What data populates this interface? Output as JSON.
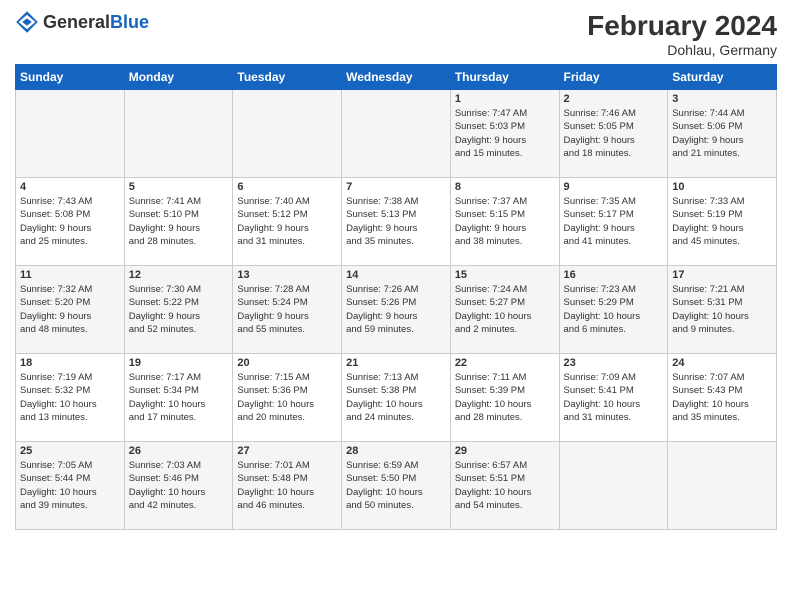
{
  "header": {
    "logo_general": "General",
    "logo_blue": "Blue",
    "main_title": "February 2024",
    "subtitle": "Dohlau, Germany"
  },
  "columns": [
    "Sunday",
    "Monday",
    "Tuesday",
    "Wednesday",
    "Thursday",
    "Friday",
    "Saturday"
  ],
  "weeks": [
    [
      {
        "day": "",
        "info": ""
      },
      {
        "day": "",
        "info": ""
      },
      {
        "day": "",
        "info": ""
      },
      {
        "day": "",
        "info": ""
      },
      {
        "day": "1",
        "info": "Sunrise: 7:47 AM\nSunset: 5:03 PM\nDaylight: 9 hours\nand 15 minutes."
      },
      {
        "day": "2",
        "info": "Sunrise: 7:46 AM\nSunset: 5:05 PM\nDaylight: 9 hours\nand 18 minutes."
      },
      {
        "day": "3",
        "info": "Sunrise: 7:44 AM\nSunset: 5:06 PM\nDaylight: 9 hours\nand 21 minutes."
      }
    ],
    [
      {
        "day": "4",
        "info": "Sunrise: 7:43 AM\nSunset: 5:08 PM\nDaylight: 9 hours\nand 25 minutes."
      },
      {
        "day": "5",
        "info": "Sunrise: 7:41 AM\nSunset: 5:10 PM\nDaylight: 9 hours\nand 28 minutes."
      },
      {
        "day": "6",
        "info": "Sunrise: 7:40 AM\nSunset: 5:12 PM\nDaylight: 9 hours\nand 31 minutes."
      },
      {
        "day": "7",
        "info": "Sunrise: 7:38 AM\nSunset: 5:13 PM\nDaylight: 9 hours\nand 35 minutes."
      },
      {
        "day": "8",
        "info": "Sunrise: 7:37 AM\nSunset: 5:15 PM\nDaylight: 9 hours\nand 38 minutes."
      },
      {
        "day": "9",
        "info": "Sunrise: 7:35 AM\nSunset: 5:17 PM\nDaylight: 9 hours\nand 41 minutes."
      },
      {
        "day": "10",
        "info": "Sunrise: 7:33 AM\nSunset: 5:19 PM\nDaylight: 9 hours\nand 45 minutes."
      }
    ],
    [
      {
        "day": "11",
        "info": "Sunrise: 7:32 AM\nSunset: 5:20 PM\nDaylight: 9 hours\nand 48 minutes."
      },
      {
        "day": "12",
        "info": "Sunrise: 7:30 AM\nSunset: 5:22 PM\nDaylight: 9 hours\nand 52 minutes."
      },
      {
        "day": "13",
        "info": "Sunrise: 7:28 AM\nSunset: 5:24 PM\nDaylight: 9 hours\nand 55 minutes."
      },
      {
        "day": "14",
        "info": "Sunrise: 7:26 AM\nSunset: 5:26 PM\nDaylight: 9 hours\nand 59 minutes."
      },
      {
        "day": "15",
        "info": "Sunrise: 7:24 AM\nSunset: 5:27 PM\nDaylight: 10 hours\nand 2 minutes."
      },
      {
        "day": "16",
        "info": "Sunrise: 7:23 AM\nSunset: 5:29 PM\nDaylight: 10 hours\nand 6 minutes."
      },
      {
        "day": "17",
        "info": "Sunrise: 7:21 AM\nSunset: 5:31 PM\nDaylight: 10 hours\nand 9 minutes."
      }
    ],
    [
      {
        "day": "18",
        "info": "Sunrise: 7:19 AM\nSunset: 5:32 PM\nDaylight: 10 hours\nand 13 minutes."
      },
      {
        "day": "19",
        "info": "Sunrise: 7:17 AM\nSunset: 5:34 PM\nDaylight: 10 hours\nand 17 minutes."
      },
      {
        "day": "20",
        "info": "Sunrise: 7:15 AM\nSunset: 5:36 PM\nDaylight: 10 hours\nand 20 minutes."
      },
      {
        "day": "21",
        "info": "Sunrise: 7:13 AM\nSunset: 5:38 PM\nDaylight: 10 hours\nand 24 minutes."
      },
      {
        "day": "22",
        "info": "Sunrise: 7:11 AM\nSunset: 5:39 PM\nDaylight: 10 hours\nand 28 minutes."
      },
      {
        "day": "23",
        "info": "Sunrise: 7:09 AM\nSunset: 5:41 PM\nDaylight: 10 hours\nand 31 minutes."
      },
      {
        "day": "24",
        "info": "Sunrise: 7:07 AM\nSunset: 5:43 PM\nDaylight: 10 hours\nand 35 minutes."
      }
    ],
    [
      {
        "day": "25",
        "info": "Sunrise: 7:05 AM\nSunset: 5:44 PM\nDaylight: 10 hours\nand 39 minutes."
      },
      {
        "day": "26",
        "info": "Sunrise: 7:03 AM\nSunset: 5:46 PM\nDaylight: 10 hours\nand 42 minutes."
      },
      {
        "day": "27",
        "info": "Sunrise: 7:01 AM\nSunset: 5:48 PM\nDaylight: 10 hours\nand 46 minutes."
      },
      {
        "day": "28",
        "info": "Sunrise: 6:59 AM\nSunset: 5:50 PM\nDaylight: 10 hours\nand 50 minutes."
      },
      {
        "day": "29",
        "info": "Sunrise: 6:57 AM\nSunset: 5:51 PM\nDaylight: 10 hours\nand 54 minutes."
      },
      {
        "day": "",
        "info": ""
      },
      {
        "day": "",
        "info": ""
      }
    ]
  ]
}
